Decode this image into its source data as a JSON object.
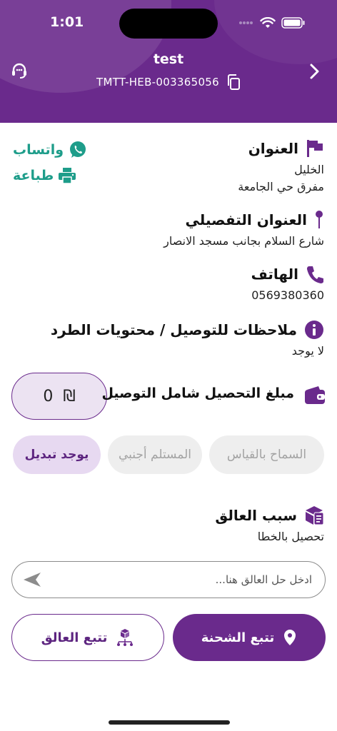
{
  "status_bar": {
    "time": "1:01"
  },
  "header": {
    "title": "test",
    "tracking_number": "TMTT-HEB-003365056"
  },
  "quick_actions": {
    "whatsapp_label": "واتساب",
    "print_label": "طباعة"
  },
  "address": {
    "title": "العنوان",
    "city": "الخليل",
    "area": "مفرق حي الجامعة"
  },
  "detailed_address": {
    "title": "العنوان التفصيلي",
    "value": "شارع السلام بجانب مسجد الانصار"
  },
  "phone": {
    "title": "الهاتف",
    "value": "0569380360"
  },
  "notes": {
    "title": "ملاحظات للتوصيل / محتويات الطرد",
    "value": "لا يوجد"
  },
  "cod": {
    "label": "مبلغ التحصيل شامل التوصيل",
    "amount": "0",
    "currency": "₪"
  },
  "options": {
    "allow_measure": "السماح بالقياس",
    "foreign_recipient": "المستلم أجنبي",
    "exchange": "يوجد تبديل"
  },
  "stuck_reason": {
    "title": "سبب العالق",
    "value": "تحصيل بالخطا"
  },
  "stuck_input": {
    "placeholder": "ادخل حل العالق هنا...",
    "value": ""
  },
  "buttons": {
    "track_shipment": "تتبع الشحنة",
    "track_stuck": "تتبع العالق"
  },
  "colors": {
    "primary": "#6a2a8c",
    "teal": "#1e9d8a",
    "chip_off": "#eeeeee",
    "chip_on": "#e7d9f1"
  }
}
